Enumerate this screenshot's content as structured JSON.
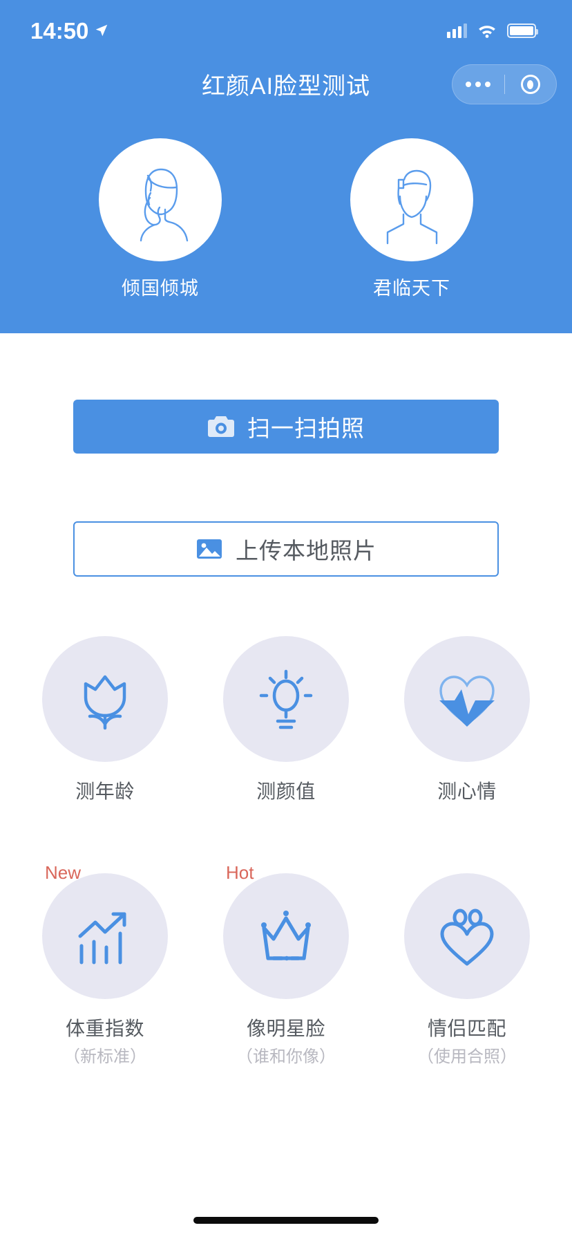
{
  "status_bar": {
    "time": "14:50",
    "location_icon": "location-arrow-icon",
    "signal_icon": "cellular-signal-icon",
    "wifi_icon": "wifi-icon",
    "battery_icon": "battery-icon"
  },
  "header": {
    "title": "红颜AI脸型测试",
    "background_color": "#4a90e2",
    "capsule": {
      "more_icon": "more-dots-icon",
      "target_icon": "target-circle-icon"
    }
  },
  "gender": {
    "items": [
      {
        "label": "倾国倾城",
        "icon": "female-avatar-icon"
      },
      {
        "label": "君临天下",
        "icon": "male-avatar-icon"
      }
    ]
  },
  "actions": {
    "camera": {
      "label": "扫一扫拍照",
      "icon": "camera-icon",
      "color": "#4a90e2"
    },
    "upload": {
      "label": "上传本地照片",
      "icon": "image-icon",
      "color": "#4a90e2"
    }
  },
  "features": {
    "row1": [
      {
        "label": "测年龄",
        "sub": "",
        "badge": "",
        "icon": "tulip-flower-icon"
      },
      {
        "label": "测颜值",
        "sub": "",
        "badge": "",
        "icon": "lightbulb-icon"
      },
      {
        "label": "测心情",
        "sub": "",
        "badge": "",
        "icon": "heart-pulse-icon"
      }
    ],
    "row2": [
      {
        "label": "体重指数",
        "sub": "（新标准）",
        "badge": "New",
        "icon": "bar-chart-arrow-icon"
      },
      {
        "label": "像明星脸",
        "sub": "（谁和你像）",
        "badge": "Hot",
        "icon": "crown-icon"
      },
      {
        "label": "情侣匹配",
        "sub": "（使用合照）",
        "badge": "",
        "icon": "couple-heart-icon"
      }
    ]
  },
  "colors": {
    "brand_blue": "#4a90e2",
    "icon_blue": "#5a9cec",
    "circle_bg": "#e7e7f2",
    "badge_red": "#d9675b",
    "label_gray": "#555a60",
    "sub_gray": "#b8b8c0"
  }
}
